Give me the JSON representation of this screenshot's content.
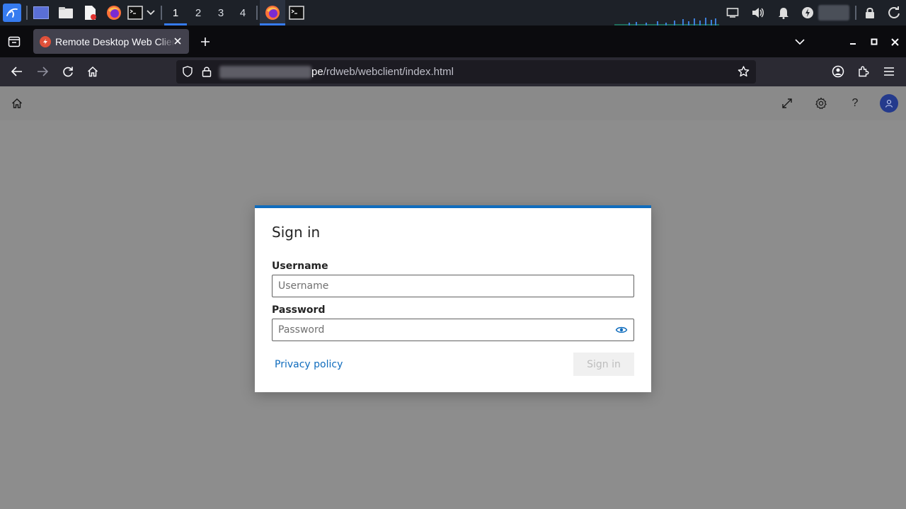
{
  "taskbar": {
    "workspaces": [
      "1",
      "2",
      "3",
      "4"
    ],
    "active_workspace": "1",
    "accent_color": "#367bf0"
  },
  "browser": {
    "tab_title": "Remote Desktop Web Client",
    "url_path": "pe/rdweb/webclient/index.html",
    "url_host_visible": "pe",
    "url_rest": "/rdweb/webclient/index.html"
  },
  "dialog": {
    "title": "Sign in",
    "username_label": "Username",
    "username_placeholder": "Username",
    "password_label": "Password",
    "password_placeholder": "Password",
    "privacy_link": "Privacy policy",
    "signin_button": "Sign in",
    "accent_color": "#0f6cbd"
  },
  "app_header": {
    "icons": [
      "home-icon",
      "fullscreen-icon",
      "settings-icon",
      "help-icon",
      "user-avatar"
    ],
    "help_glyph": "?"
  }
}
